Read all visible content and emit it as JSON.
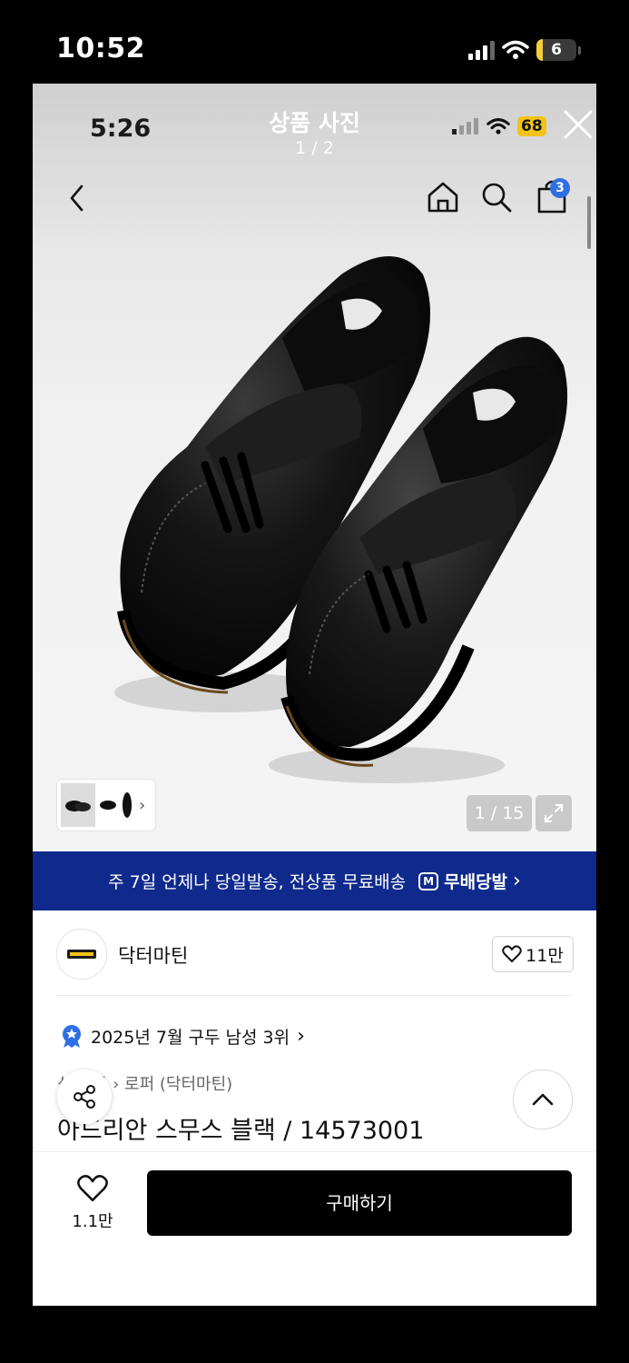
{
  "outer_status": {
    "time": "10:52",
    "battery": "6"
  },
  "inner_status": {
    "time": "5:26",
    "battery": "68"
  },
  "viewer": {
    "title": "상품 사진",
    "counter": "1 / 2"
  },
  "nav": {
    "cart_count": "3"
  },
  "gallery": {
    "counter": "1 / 15"
  },
  "promo": {
    "text": "주 7일 언제나 당일발송, 전상품 무료배송",
    "brand_tag": "M",
    "brand_text": "무배당발",
    "arrow": "›"
  },
  "brand": {
    "name": "닥터마틴",
    "likes": "11만"
  },
  "ranking": {
    "text": "2025년 7월 구두 남성 3위",
    "arrow": "›"
  },
  "breadcrumb": "신    구두 › 로퍼 (닥터마틴)",
  "product": {
    "title": "아드리안 스무스 블랙 / 14573001"
  },
  "bottom": {
    "wish_count": "1.1만",
    "buy_label": "구매하기"
  },
  "icons": [
    "signal-icon",
    "wifi-icon",
    "battery-icon",
    "close-icon",
    "back-icon",
    "home-icon",
    "search-icon",
    "cart-icon",
    "chevron-right-icon",
    "expand-icon",
    "delivery-icon",
    "heart-icon",
    "rank-badge-icon",
    "share-icon",
    "chevron-up-icon"
  ],
  "colors": {
    "promo_bg": "#0f2a8c",
    "badge": "#2f6fe4",
    "buy_bg": "#000000",
    "battery_outer": "#f4cf3b",
    "battery_inner": "#f2c318"
  }
}
